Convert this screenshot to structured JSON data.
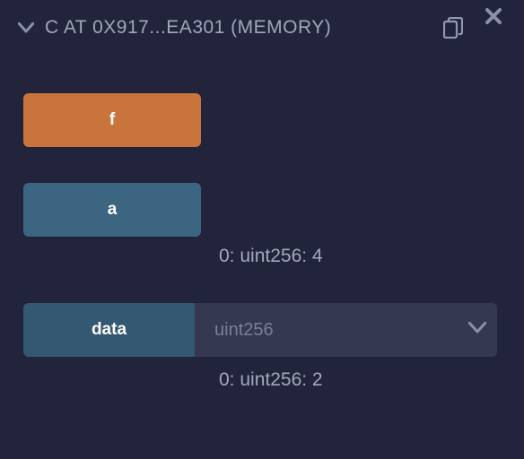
{
  "header": {
    "title": "C AT 0X917...EA301 (MEMORY)"
  },
  "functions": {
    "f": {
      "label": "f"
    },
    "a": {
      "label": "a",
      "output": "0: uint256: 4"
    },
    "data": {
      "label": "data",
      "placeholder": "uint256",
      "output": "0: uint256: 2"
    }
  }
}
